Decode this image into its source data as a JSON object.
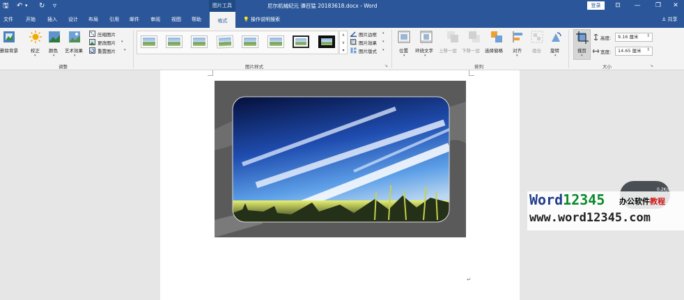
{
  "titlebar": {
    "qat": {
      "save": "🖫",
      "undo": "↶",
      "undo_menu": "▾",
      "redo": "↻",
      "customize": "▿"
    },
    "context_tool": "图片工具",
    "doc_title": "尼尔机械纪元 谭召猛 20183618.docx  -  Word",
    "login": "登录",
    "win": {
      "ribbon_opts": "⊡",
      "minimize": "—",
      "restore": "❐",
      "close": "✕"
    }
  },
  "tabs": [
    "文件",
    "开始",
    "插入",
    "设计",
    "布局",
    "引用",
    "邮件",
    "审阅",
    "视图",
    "帮助",
    "格式"
  ],
  "active_tab": "格式",
  "tellme": {
    "icon": "💡",
    "label": "操作说明搜索"
  },
  "share": {
    "icon": "♙",
    "label": "共享"
  },
  "ribbon": {
    "adjust": {
      "remove_bg": "删除背景",
      "correct": "校正",
      "color": "颜色",
      "artistic": "艺术效果",
      "compress": "压缩图片",
      "change": "更改图片",
      "reset": "重置图片",
      "group": "调整"
    },
    "styles": {
      "border": "图片边框",
      "effects": "图片效果",
      "layout": "图片版式",
      "group": "图片样式"
    },
    "arrange": {
      "position": "位置",
      "wrap": "环绕文字",
      "forward": "上移一层",
      "backward": "下移一层",
      "selection": "选择窗格",
      "align": "对齐",
      "group_btn": "组合",
      "rotate": "旋转",
      "group": "排列"
    },
    "size": {
      "crop": "裁剪",
      "height_label": "高度:",
      "height_value": "9.16 厘米",
      "width_label": "宽度:",
      "width_value": "14.65 厘米",
      "group": "大小"
    }
  },
  "doc": {
    "para_mark": "↵"
  },
  "watermark": {
    "brand_a": "Word",
    "brand_b": "12345",
    "sub_a": "办公软件",
    "sub_b": "教程",
    "url": "www.word12345.com",
    "speed": "0.2K/s"
  },
  "colors": {
    "accent": "#2b579a",
    "ribbon_bg": "#f3f3f3",
    "doc_bg": "#e6e6e6"
  }
}
